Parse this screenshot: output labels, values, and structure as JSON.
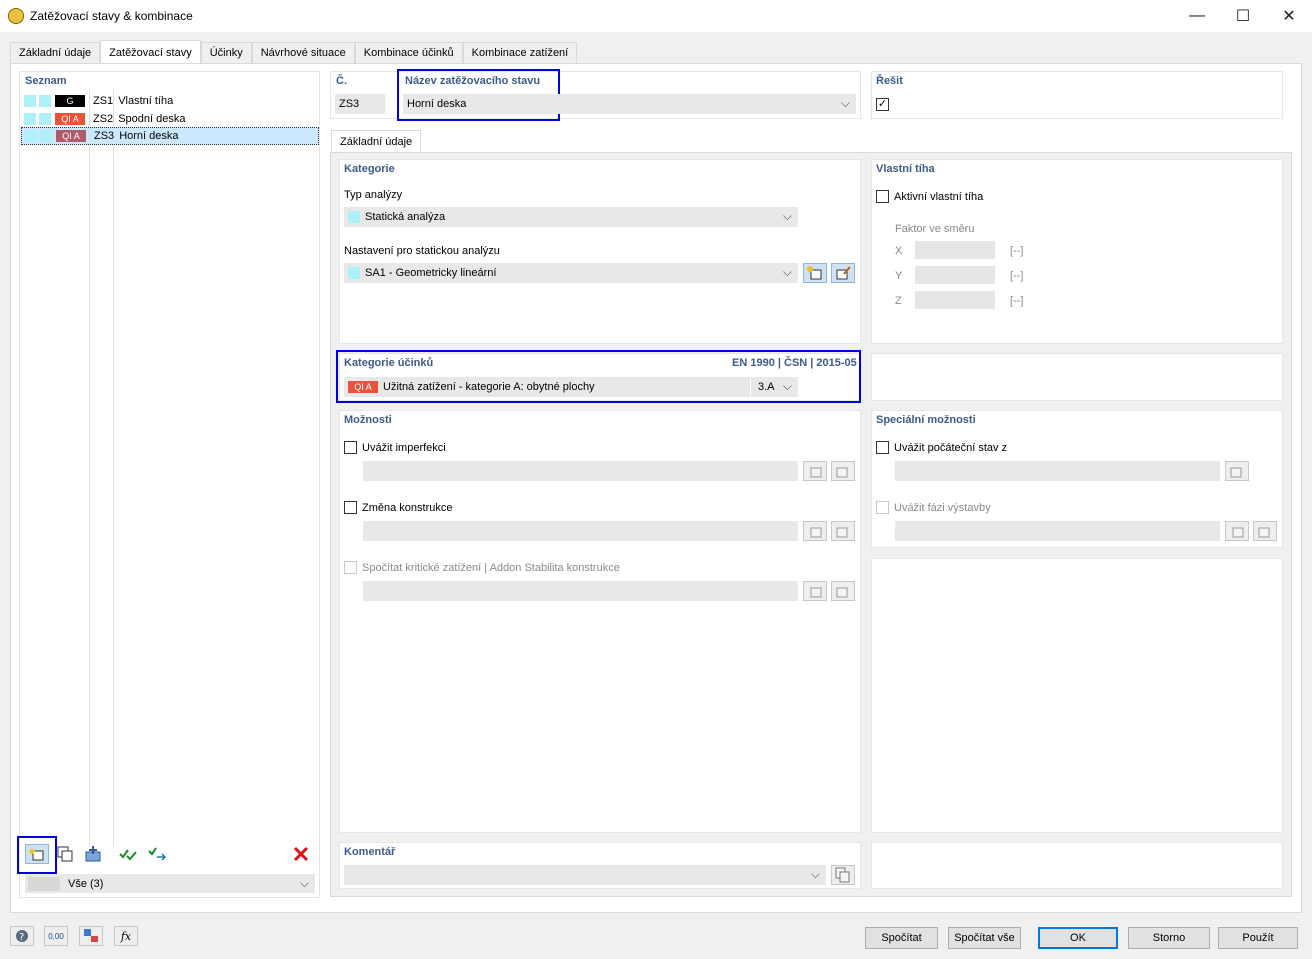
{
  "window": {
    "title": "Zatěžovací stavy & kombinace",
    "minimize": "—",
    "maximize": "☐",
    "close": "✕"
  },
  "tabs": [
    {
      "label": "Základní údaje"
    },
    {
      "label": "Zatěžovací stavy"
    },
    {
      "label": "Účinky"
    },
    {
      "label": "Návrhové situace"
    },
    {
      "label": "Kombinace účinků"
    },
    {
      "label": "Kombinace zatížení"
    }
  ],
  "list": {
    "title": "Seznam",
    "items": [
      {
        "cat": "G",
        "cat_color": "#000000",
        "id": "ZS1",
        "name": "Vlastní tíha"
      },
      {
        "cat": "QI A",
        "cat_color": "#e8533a",
        "id": "ZS2",
        "name": "Spodní deska"
      },
      {
        "cat": "QI A",
        "cat_color": "#b05a6a",
        "id": "ZS3",
        "name": "Horní deska"
      }
    ],
    "filter": "Vše (3)"
  },
  "header": {
    "no_label": "Č.",
    "no_value": "ZS3",
    "name_label": "Název zatěžovacího stavu",
    "name_value": "Horní deska",
    "solve_label": "Řešit",
    "solve_checked": "✓"
  },
  "subtab": "Základní údaje",
  "category": {
    "title": "Kategorie",
    "analysis_label": "Typ analýzy",
    "analysis_value": "Statická analýza",
    "settings_label": "Nastavení pro statickou analýzu",
    "settings_value": "SA1 - Geometricky lineární"
  },
  "selfweight": {
    "title": "Vlastní tíha",
    "active_label": "Aktivní vlastní tíha",
    "factor_label": "Faktor ve směru",
    "x": "X",
    "y": "Y",
    "z": "Z",
    "unit": "[--]"
  },
  "action_category": {
    "title": "Kategorie účinků",
    "standard": "EN 1990 | ČSN | 2015-05",
    "badge": "QI A",
    "value": "Užitná zatížení - kategorie A: obytné plochy",
    "code": "3.A"
  },
  "options": {
    "title": "Možnosti",
    "imperfection": "Uvážit imperfekci",
    "structure_change": "Změna konstrukce",
    "critical_load": "Spočítat kritické zatížení | Addon Stabilita konstrukce"
  },
  "special": {
    "title": "Speciální možnosti",
    "initial_state": "Uvážit počáteční stav z",
    "construction_phase": "Uvážit fázi výstavby"
  },
  "comment": {
    "title": "Komentář"
  },
  "buttons": {
    "calculate": "Spočítat",
    "calculate_all": "Spočítat vše",
    "ok": "OK",
    "cancel": "Storno",
    "apply": "Použít"
  },
  "bottom_icons": {
    "numbers": "0,00"
  }
}
